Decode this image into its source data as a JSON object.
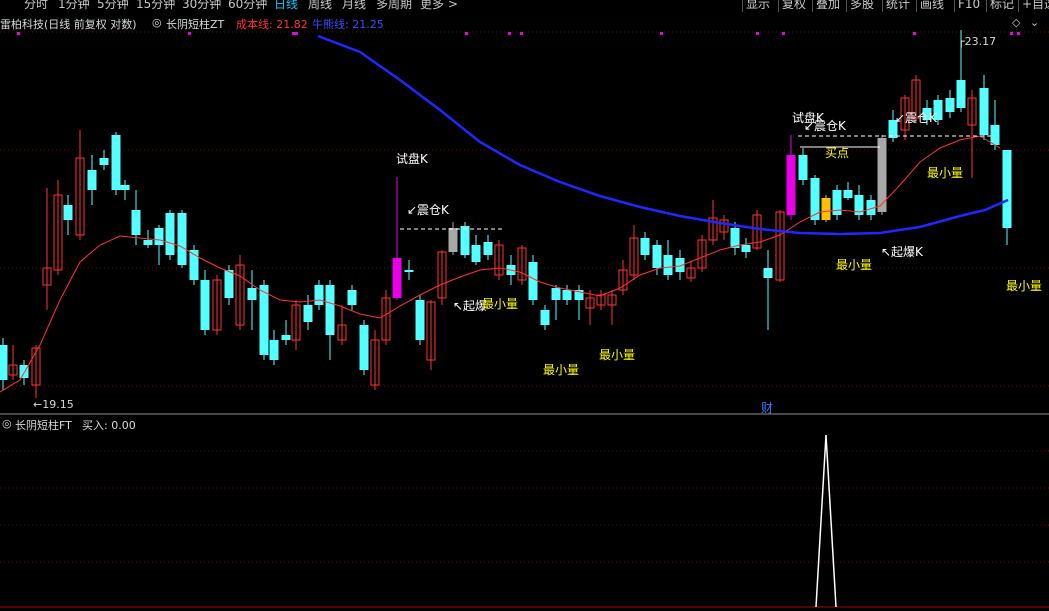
{
  "toolbar": {
    "periods": [
      "分时",
      "1分钟",
      "5分钟",
      "15分钟",
      "30分钟",
      "60分钟",
      "日线",
      "周线",
      "月线",
      "多周期",
      "更多 >"
    ],
    "active_period": "日线",
    "right_buttons": [
      "显示",
      "复权",
      "叠加",
      "多股",
      "统计",
      "画线",
      "F10",
      "标记",
      "+自选"
    ]
  },
  "main_header": {
    "stock": "雷柏科技(日线 前复权 对数)",
    "indicator": "长阴短柱ZT",
    "cost_label": "成本线: 21.82",
    "bull_label": "牛熊线: 21.25"
  },
  "sub_header": {
    "indicator": "长阴短柱FT",
    "buy_label": "买入: 0.00"
  },
  "markers": {
    "high": "23.17",
    "low": "19.15",
    "cai": "财"
  },
  "annotations": {
    "shipan_1": "试盘K",
    "zhencang_1": "↙震仓K",
    "qibao_1": "↖起爆",
    "zuixiao_1": "最小量",
    "zuixiao_2": "最小量",
    "zuixiao_3": "最小量",
    "shipan_2": "试盘K",
    "zhencang_2": "↙震仓K",
    "maidian": "买点",
    "zhencang_3": "↙震仓K",
    "zuixiao_4": "最小量",
    "qibao_2": "↖起爆K",
    "zuixiao_5": "最小量",
    "zuixiao_6": "最小量"
  },
  "colors": {
    "up": "#ff3232",
    "down": "#54ffff",
    "ma": "#ff3232",
    "bull_line": "#1e28ff",
    "cost_text": "#ff3232",
    "bull_text": "#3c4bff",
    "magenta": "#e800e8",
    "gold": "#ffc000",
    "gray": "#a8a8a8",
    "annotation_white": "#ffffff",
    "annotation_yellow": "#ffff00",
    "grid": "#7a0000"
  },
  "chart_data": {
    "type": "candlestick",
    "title": "雷柏科技(日线 前复权 对数)",
    "y_markers": {
      "high": 23.17,
      "low": 19.15
    },
    "series": [
      {
        "name": "成本线",
        "last": 21.82
      },
      {
        "name": "牛熊线",
        "last": 21.25
      },
      {
        "name": "买入",
        "last": 0.0
      }
    ]
  }
}
